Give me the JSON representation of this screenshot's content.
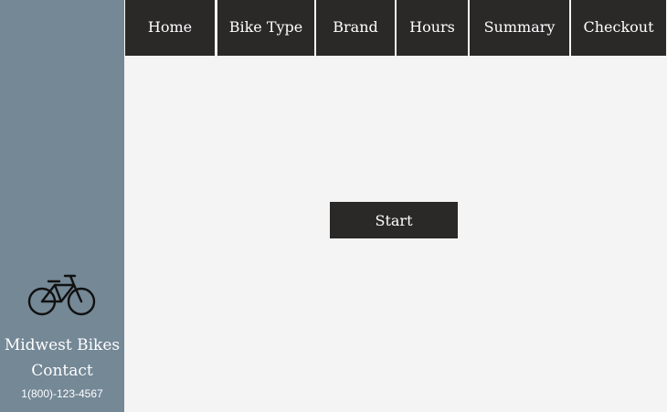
{
  "nav": {
    "tabs": [
      {
        "label": "Home"
      },
      {
        "label": "Bike Type"
      },
      {
        "label": "Brand"
      },
      {
        "label": "Hours"
      },
      {
        "label": "Summary"
      },
      {
        "label": "Checkout"
      }
    ]
  },
  "main": {
    "start_label": "Start"
  },
  "sidebar": {
    "logo_icon": "bicycle-icon",
    "brand_name": "Midwest Bikes",
    "contact_label": "Contact",
    "phone": "1(800)-123-4567"
  },
  "colors": {
    "sidebar_bg": "#748896",
    "nav_bg": "#2b2828",
    "page_bg": "#f4f4f4"
  }
}
